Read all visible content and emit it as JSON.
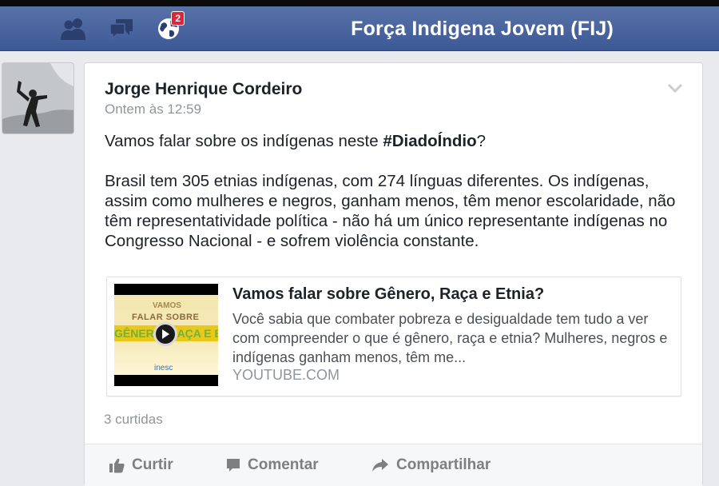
{
  "navbar": {
    "title": "Força Indigena Jovem (FIJ)",
    "notification_count": "2",
    "icons": [
      "friends-icon",
      "messages-icon",
      "notifications-globe-icon"
    ],
    "color": "#3d5995"
  },
  "post": {
    "author": "Jorge Henrique Cordeiro",
    "timestamp": "Ontem às 12:59",
    "text_intro_before": "Vamos falar sobre os indígenas neste ",
    "hashtag": "#DiadoÍndio",
    "text_intro_after": "?",
    "text_body": "Brasil tem 305 etnias indígenas, com 274 línguas diferentes. Os indígenas, assim como mulheres e negros, ganham menos, têm menor escolaridade, não têm representatividade política - não há um único representante indígenas no Congresso Nacional - e sofrem violência constante.",
    "link": {
      "thumbnail_text": [
        "VAMOS",
        "FALAR SOBRE",
        "GÊNERO, RAÇA E ETNIA",
        "inesc"
      ],
      "title": "Vamos falar sobre Gênero, Raça e Etnia?",
      "description": "Você sabia que combater pobreza e desigualdade tem tudo a ver com compreender o que é gênero, raça e etnia? Mulheres, negros e indígenas ganham menos, têm me...",
      "domain": "YOUTUBE.COM"
    },
    "likes": "3 curtidas",
    "actions": {
      "like": "Curtir",
      "comment": "Comentar",
      "share": "Compartilhar"
    }
  }
}
